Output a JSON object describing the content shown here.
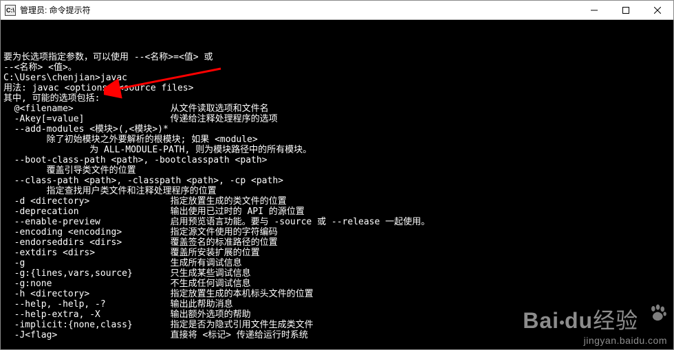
{
  "window": {
    "title": "管理员: 命令提示符",
    "icon_label": "C:\\"
  },
  "terminal": {
    "lines": [
      "要为长选项指定参数，可以使用 --<名称>=<值> 或",
      "--<名称> <值>。",
      "",
      "C:\\Users\\chenjian>javac",
      "用法: javac <options> <source files>",
      "其中, 可能的选项包括:",
      "  @<filename>                  从文件读取选项和文件名",
      "  -Akey[=value]                传递给注释处理程序的选项",
      "  --add-modules <模块>(,<模块>)*",
      "        除了初始模块之外要解析的根模块; 如果 <module>",
      "                为 ALL-MODULE-PATH, 则为模块路径中的所有模块。",
      "  --boot-class-path <path>, -bootclasspath <path>",
      "        覆盖引导类文件的位置",
      "  --class-path <path>, -classpath <path>, -cp <path>",
      "        指定查找用户类文件和注释处理程序的位置",
      "  -d <directory>               指定放置生成的类文件的位置",
      "  -deprecation                 输出使用已过时的 API 的源位置",
      "  --enable-preview             启用预览语言功能。要与 -source 或 --release 一起使用。",
      "  -encoding <encoding>         指定源文件使用的字符编码",
      "  -endorseddirs <dirs>         覆盖签名的标准路径的位置",
      "  -extdirs <dirs>              覆盖所安装扩展的位置",
      "  -g                           生成所有调试信息",
      "  -g:{lines,vars,source}       只生成某些调试信息",
      "  -g:none                      不生成任何调试信息",
      "  -h <directory>               指定放置生成的本机标头文件的位置",
      "  --help, -help, -?            输出此帮助消息",
      "  --help-extra, -X             输出额外选项的帮助",
      "  -implicit:{none,class}       指定是否为隐式引用文件生成类文件",
      "  -J<flag>                     直接将 <标记> 传递给运行时系统"
    ]
  },
  "watermark": {
    "brand1": "Bai",
    "brand2": "du",
    "brand3": "经验",
    "url": "jingyan.baidu.com"
  },
  "arrow_color": "#ff0000"
}
